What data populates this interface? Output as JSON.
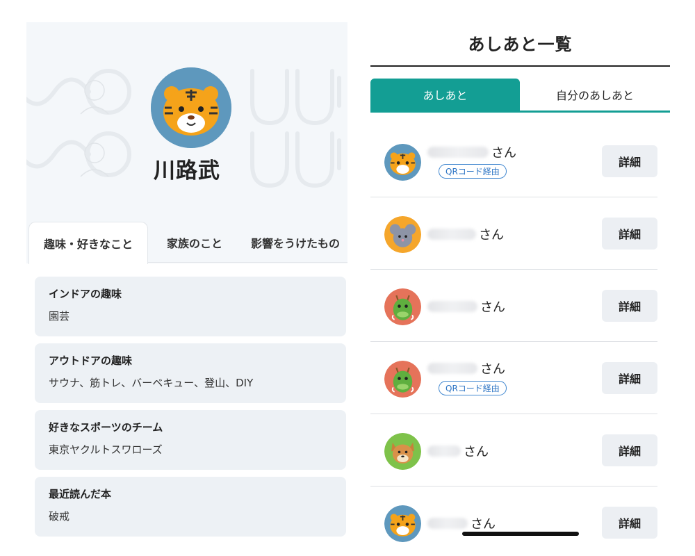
{
  "profile": {
    "name": "川路武",
    "avatar_icon": "tiger-icon",
    "background_watermark": "jinjo-logo-pattern"
  },
  "profile_tabs": [
    {
      "label": "趣味・好きなこと",
      "active": true
    },
    {
      "label": "家族のこと",
      "active": false
    },
    {
      "label": "影響をうけたもの",
      "active": false
    }
  ],
  "profile_cards": [
    {
      "title": "インドアの趣味",
      "value": "園芸"
    },
    {
      "title": "アウトドアの趣味",
      "value": "サウナ、筋トレ、バーベキュー、登山、DIY"
    },
    {
      "title": "好きなスポーツのチーム",
      "value": "東京ヤクルトスワローズ"
    },
    {
      "title": "最近読んだ本",
      "value": "破戒"
    }
  ],
  "footprints": {
    "title": "あしあと一覧",
    "tabs": [
      {
        "label": "あしあと",
        "active": true
      },
      {
        "label": "自分のあしあと",
        "active": false
      }
    ],
    "visitors": [
      {
        "avatar": "tiger-icon",
        "suffix": "さん",
        "badge": "QRコード経由",
        "button": "詳細"
      },
      {
        "avatar": "mouse-icon",
        "suffix": "さん",
        "badge": null,
        "button": "詳細"
      },
      {
        "avatar": "dragon-icon",
        "suffix": "さん",
        "badge": null,
        "button": "詳細"
      },
      {
        "avatar": "dragon-icon",
        "suffix": "さん",
        "badge": "QRコード経由",
        "button": "詳細"
      },
      {
        "avatar": "dog-icon",
        "suffix": "さん",
        "badge": null,
        "button": "詳細"
      },
      {
        "avatar": "tiger-icon",
        "suffix": "さん",
        "badge": null,
        "button": "詳細"
      }
    ]
  },
  "colors": {
    "accent": "#139e94",
    "badge": "#2c74c4",
    "card_bg": "#edf1f5",
    "hero_bg": "#f4f7fa"
  }
}
